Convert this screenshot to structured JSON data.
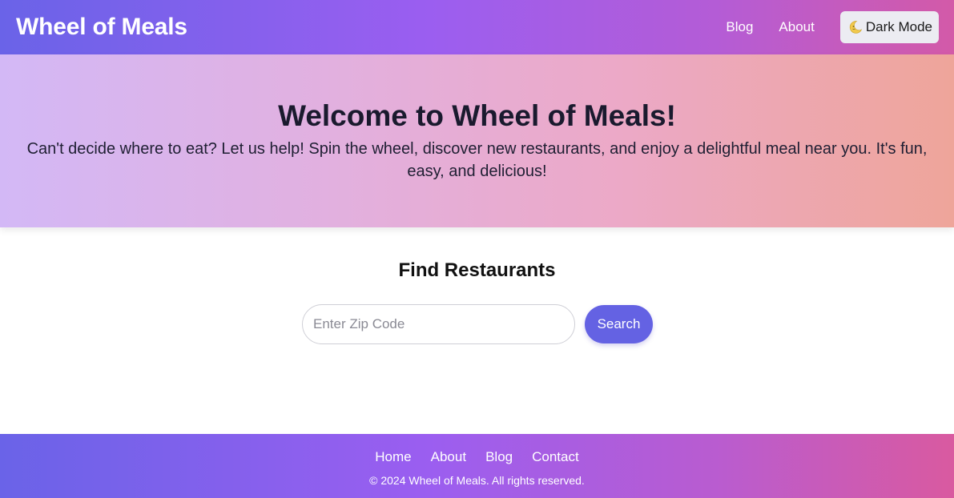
{
  "header": {
    "logo": "Wheel of Meals",
    "nav": [
      {
        "label": "Blog"
      },
      {
        "label": "About"
      }
    ],
    "dark_mode": {
      "label": "Dark Mode",
      "icon": "moon-icon"
    }
  },
  "hero": {
    "title": "Welcome to Wheel of Meals!",
    "text": "Can't decide where to eat? Let us help! Spin the wheel, discover new restaurants, and enjoy a delightful meal near you. It's fun, easy, and delicious!"
  },
  "search": {
    "title": "Find Restaurants",
    "placeholder": "Enter Zip Code",
    "value": "",
    "button": "Search"
  },
  "footer": {
    "links": [
      {
        "label": "Home"
      },
      {
        "label": "About"
      },
      {
        "label": "Blog"
      },
      {
        "label": "Contact"
      }
    ],
    "copyright": "© 2024 Wheel of Meals. All rights reserved."
  },
  "colors": {
    "accent": "#6462e3",
    "gradient_start": "#6a63e8",
    "gradient_end": "#d35aa8"
  }
}
